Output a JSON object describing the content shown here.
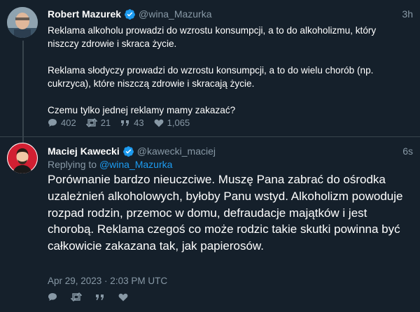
{
  "tweet1": {
    "name": "Robert Mazurek",
    "handle": "@wina_Mazurka",
    "time": "3h",
    "paragraphs": [
      "Reklama alkoholu prowadzi do wzrostu konsumpcji, a to do alkoholizmu, który niszczy zdrowie i skraca życie.",
      "Reklama słodyczy prowadzi do wzrostu konsumpcji, a to do wielu chorób (np. cukrzyca), które niszczą zdrowie i skracają życie.",
      "Czemu tylko jednej reklamy mamy zakazać?"
    ],
    "replies": "402",
    "retweets": "21",
    "quotes": "43",
    "likes": "1,065"
  },
  "tweet2": {
    "name": "Maciej Kawecki",
    "handle": "@kawecki_maciej",
    "time": "6s",
    "replying_label": "Replying to",
    "replying_to": "@wina_Mazurka",
    "text": "Porównanie bardzo nieuczciwe. Muszę Pana zabrać do ośrodka uzależnień alkoholowych, byłoby Panu wstyd. Alkoholizm powoduje rozpad rodzin, przemoc w domu, defraudacje majątków i jest chorobą. Reklama czegoś co może rodzic takie skutki powinna być całkowicie zakazana tak, jak papierosów.",
    "date": "Apr 29, 2023 · 2:03 PM UTC"
  },
  "colors": {
    "background": "#15202b",
    "secondary_text": "#8899a6",
    "link": "#1d9bf0",
    "divider": "#38444d"
  },
  "icons": [
    "verified-badge-icon",
    "reply-icon",
    "retweet-icon",
    "quote-icon",
    "like-icon"
  ]
}
